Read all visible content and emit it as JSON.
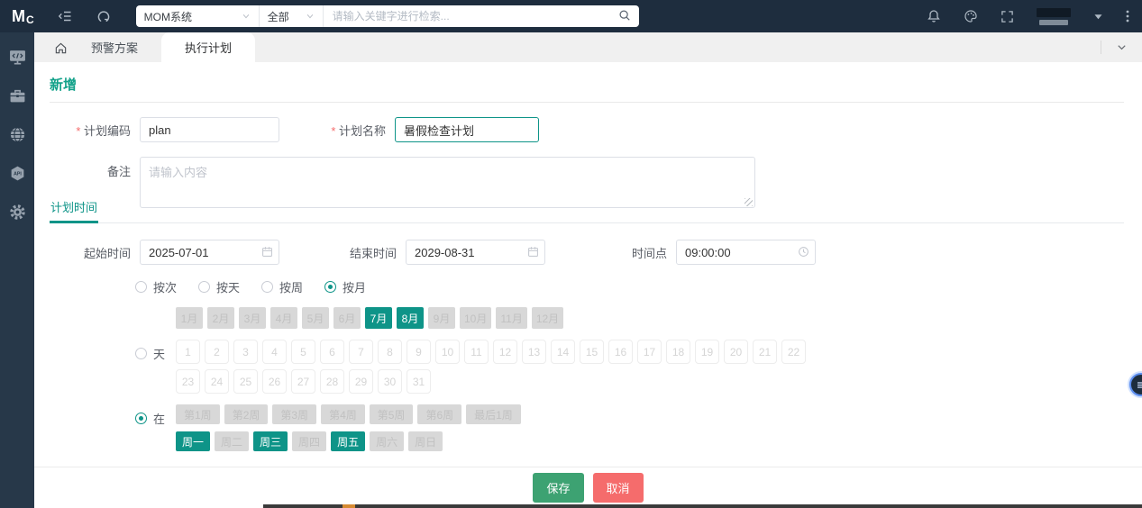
{
  "topbar": {
    "logo_m": "M",
    "logo_c": "C",
    "system_select": {
      "value": "MOM系统"
    },
    "scope_select": {
      "value": "全部"
    },
    "search": {
      "placeholder": "请输入关键字进行检索..."
    }
  },
  "sidebar": {
    "items": [
      {
        "icon": "monitor-code-icon"
      },
      {
        "icon": "briefcase-icon"
      },
      {
        "icon": "globe-icon"
      },
      {
        "icon": "api-icon"
      },
      {
        "icon": "gear-icon"
      }
    ]
  },
  "tabbar": {
    "tabs": [
      {
        "label": "预警方案",
        "active": false
      },
      {
        "label": "执行计划",
        "active": true
      }
    ]
  },
  "page": {
    "title": "新增",
    "fields": {
      "plan_code": {
        "label": "计划编码",
        "required": true,
        "value": "plan"
      },
      "plan_name": {
        "label": "计划名称",
        "required": true,
        "value": "暑假检查计划"
      },
      "remark": {
        "label": "备注",
        "required": false,
        "placeholder": "请输入内容",
        "value": ""
      }
    },
    "section_tab": "计划时间",
    "time": {
      "start": {
        "label": "起始时间",
        "value": "2025-07-01"
      },
      "end": {
        "label": "结束时间",
        "value": "2029-08-31"
      },
      "point": {
        "label": "时间点",
        "value": "09:00:00"
      }
    },
    "frequency": [
      {
        "label": "按次",
        "checked": false
      },
      {
        "label": "按天",
        "checked": false
      },
      {
        "label": "按周",
        "checked": false
      },
      {
        "label": "按月",
        "checked": true
      }
    ],
    "months": [
      {
        "label": "1月"
      },
      {
        "label": "2月"
      },
      {
        "label": "3月"
      },
      {
        "label": "4月"
      },
      {
        "label": "5月"
      },
      {
        "label": "6月"
      },
      {
        "label": "7月",
        "selected": true
      },
      {
        "label": "8月",
        "selected": true
      },
      {
        "label": "9月"
      },
      {
        "label": "10月"
      },
      {
        "label": "11月"
      },
      {
        "label": "12月"
      }
    ],
    "day_mode": {
      "label": "天",
      "checked": false
    },
    "days": [
      "1",
      "2",
      "3",
      "4",
      "5",
      "6",
      "7",
      "8",
      "9",
      "10",
      "11",
      "12",
      "13",
      "14",
      "15",
      "16",
      "17",
      "18",
      "19",
      "20",
      "21",
      "22",
      "23",
      "24",
      "25",
      "26",
      "27",
      "28",
      "29",
      "30",
      "31"
    ],
    "week_mode": {
      "label": "在",
      "checked": true
    },
    "weeks": [
      {
        "label": "第1周"
      },
      {
        "label": "第2周"
      },
      {
        "label": "第3周"
      },
      {
        "label": "第4周"
      },
      {
        "label": "第5周"
      },
      {
        "label": "第6周"
      },
      {
        "label": "最后1周"
      }
    ],
    "weekdays": [
      {
        "label": "周一",
        "selected": true
      },
      {
        "label": "周二"
      },
      {
        "label": "周三",
        "selected": true
      },
      {
        "label": "周四"
      },
      {
        "label": "周五",
        "selected": true
      },
      {
        "label": "周六"
      },
      {
        "label": "周日"
      }
    ],
    "actions": {
      "save": "保存",
      "cancel": "取消"
    }
  },
  "colors": {
    "primary_teal": "#0e9488",
    "save_green": "#3da272",
    "cancel_red": "#f56c6c",
    "topbar_bg": "#1e2d3e",
    "sidebar_bg": "#273849",
    "tabbar_bg": "#f0f0f0"
  }
}
